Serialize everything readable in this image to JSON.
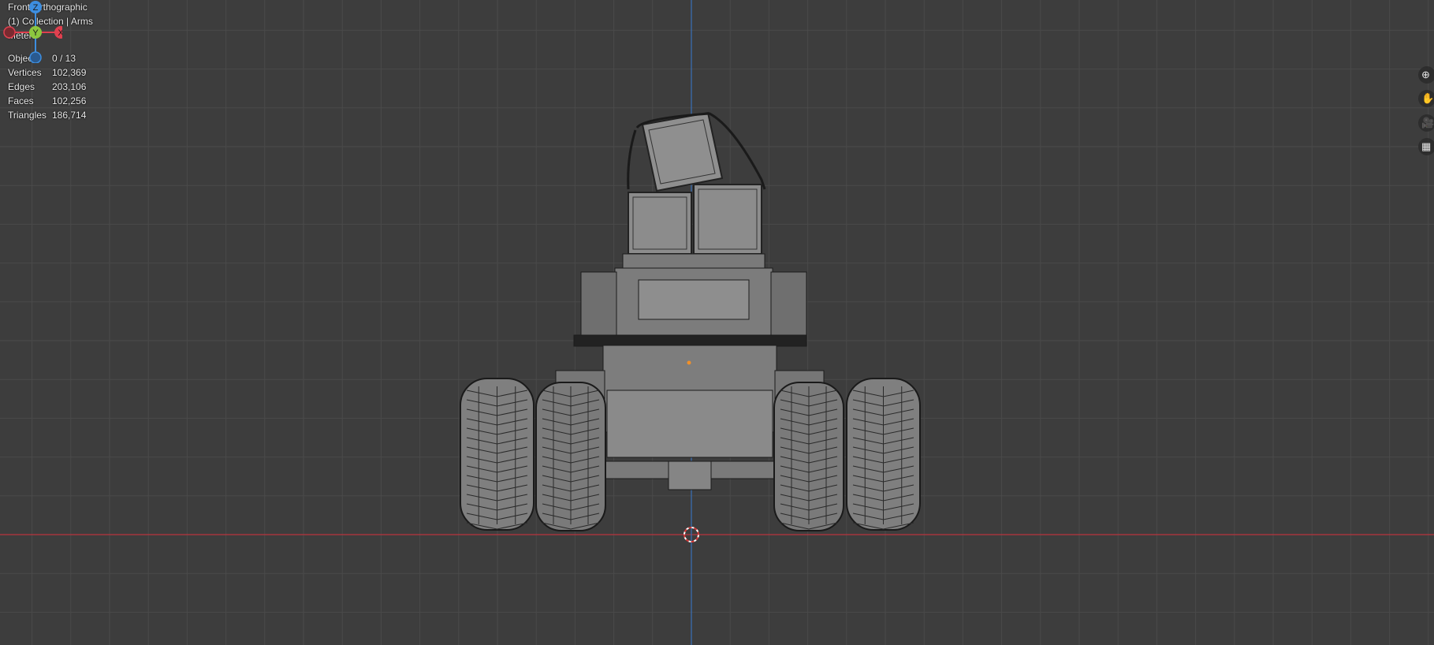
{
  "viewport": {
    "view_name": "Front Orthographic",
    "collection_line": "(1) Collection | Arms",
    "units": "Meters",
    "stats": [
      {
        "label": "Objects",
        "value": "0 / 13"
      },
      {
        "label": "Vertices",
        "value": "102,369"
      },
      {
        "label": "Edges",
        "value": "203,106"
      },
      {
        "label": "Faces",
        "value": "102,256"
      },
      {
        "label": "Triangles",
        "value": "186,714"
      }
    ]
  },
  "gizmo": {
    "z_label": "Z",
    "y_label": "Y",
    "x_label": "X",
    "colors": {
      "x": "#e0404f",
      "y": "#8cc63f",
      "z": "#3d8ee0"
    }
  },
  "nav_tools": [
    {
      "name": "zoom-icon",
      "glyph": "⊕"
    },
    {
      "name": "pan-hand-icon",
      "glyph": "✋"
    },
    {
      "name": "camera-icon",
      "glyph": "🎥"
    },
    {
      "name": "grid-icon",
      "glyph": "▦"
    }
  ],
  "colors": {
    "background": "#3d3d3d",
    "grid": "#4a4a4a",
    "x_axis": "#c2343e",
    "z_axis": "#3a6fb0"
  }
}
